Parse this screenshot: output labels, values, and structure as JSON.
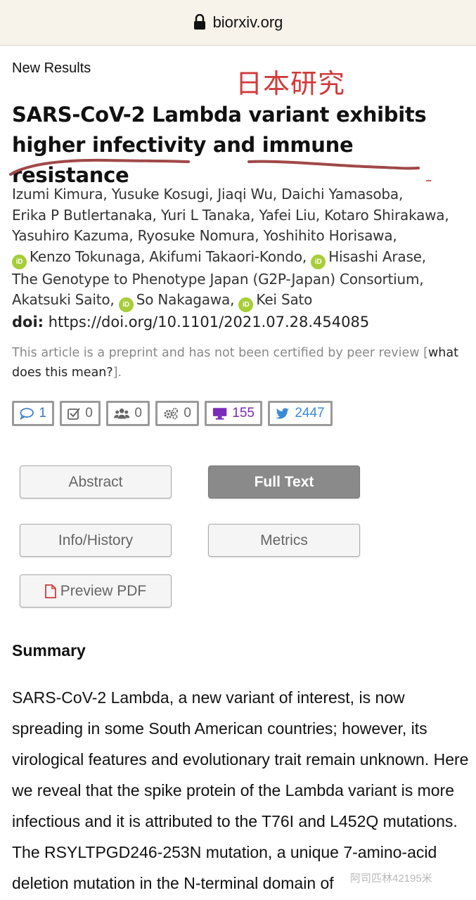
{
  "browser": {
    "url": "biorxiv.org",
    "icons": {
      "lock": "lock-icon"
    }
  },
  "article": {
    "section": "New Results",
    "annotation": "日本研究",
    "title": "SARS-CoV-2 Lambda variant exhibits higher infectivity and immune resistance",
    "authors_lines": [
      "Izumi Kimura, Yusuke Kosugi, Jiaqi Wu, Daichi Yamasoba,",
      "Erika P Butlertanaka, Yuri L Tanaka, Yafei Liu, Kotaro Shirakawa,",
      "Yasuhiro Kazuma, Ryosuke Nomura, Yoshihito Horisawa,"
    ],
    "authors_orcid": {
      "a1": "Kenzo Tokunaga, Akifumi Takaori-Kondo,",
      "a2": "Hisashi Arase,",
      "consortium": "The Genotype to Phenotype Japan (G2P-Japan) Consortium,",
      "a3": "Akatsuki Saito,",
      "a4": "So Nakagawa,",
      "a5": "Kei Sato",
      "orcid_glyph": "iD"
    },
    "doi_label": "doi:",
    "doi": "https://doi.org/10.1101/2021.07.28.454085",
    "preprint_note": "This article is a preprint and has not been certified by peer review [",
    "preprint_link": "what does this mean?",
    "preprint_close": "]."
  },
  "metrics": {
    "comments": "1",
    "reviews": "0",
    "community": "0",
    "automated": "0",
    "online": "155",
    "twitter": "2447",
    "colors": {
      "online": "#7a2ab8",
      "twitter": "#3a8ad6"
    }
  },
  "tabs": {
    "abstract": "Abstract",
    "full_text": "Full Text",
    "info_history": "Info/History",
    "metrics": "Metrics",
    "preview_pdf": "Preview PDF",
    "active": "Full Text"
  },
  "summary": {
    "heading": "Summary",
    "text": "SARS-CoV-2 Lambda, a new variant of interest, is now spreading in some South American countries; however, its virological features and evolutionary trait remain unknown. Here we reveal that the spike protein of the Lambda variant is more infectious and it is attributed to the T76I and L452Q mutations. The RSYLTPGD246-253N mutation, a unique 7-amino-acid deletion mutation in the N-terminal domain of"
  },
  "watermark": "阿司匹林42195米",
  "colors": {
    "annotation": "#d23a3a",
    "orcid": "#a6ce39"
  }
}
